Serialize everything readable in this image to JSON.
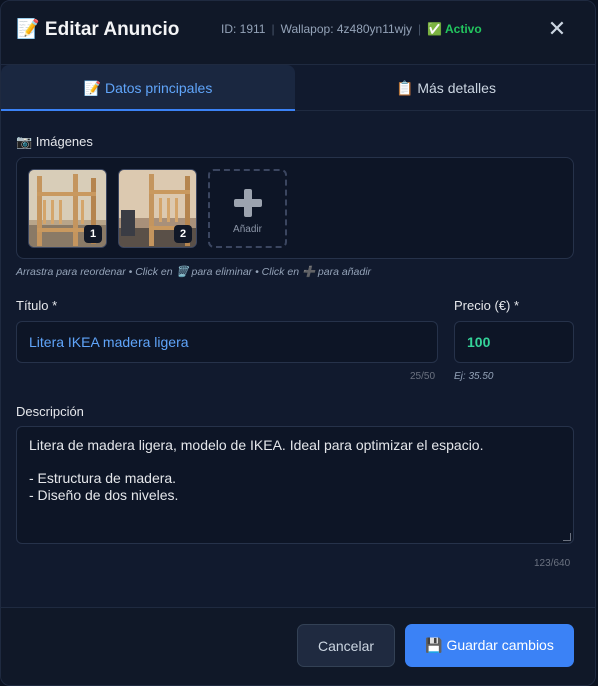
{
  "header": {
    "title": "📝 Editar Anuncio",
    "id_text": "ID: 1911",
    "wallapop_text": "Wallapop: 4z480yn11wjy",
    "status": "✅ Activo",
    "close_glyph": "✕",
    "separator": "|"
  },
  "tabs": [
    {
      "label": "📝 Datos principales",
      "active": true
    },
    {
      "label": "📋 Más detalles",
      "active": false
    }
  ],
  "images": {
    "label": "📷 Imágenes",
    "items": [
      {
        "index": "1"
      },
      {
        "index": "2"
      }
    ],
    "add_label": "Añadir",
    "hint": "Arrastra para reordenar • Click en 🗑️ para eliminar • Click en ➕ para añadir"
  },
  "title_field": {
    "label": "Título *",
    "value": "Litera IKEA madera ligera",
    "counter": "25/50"
  },
  "price_field": {
    "label": "Precio (€) *",
    "value": "100",
    "hint": "Ej: 35.50"
  },
  "description": {
    "label": "Descripción",
    "value": "Litera de madera ligera, modelo de IKEA. Ideal para optimizar el espacio.\n\n- Estructura de madera.\n- Diseño de dos niveles.",
    "counter": "123/640"
  },
  "footer": {
    "cancel_label": "Cancelar",
    "save_label": "💾 Guardar cambios"
  },
  "colors": {
    "accent": "#3b82f6",
    "status_green": "#22c55e",
    "price_green": "#34d399",
    "title_blue": "#60a5fa"
  }
}
